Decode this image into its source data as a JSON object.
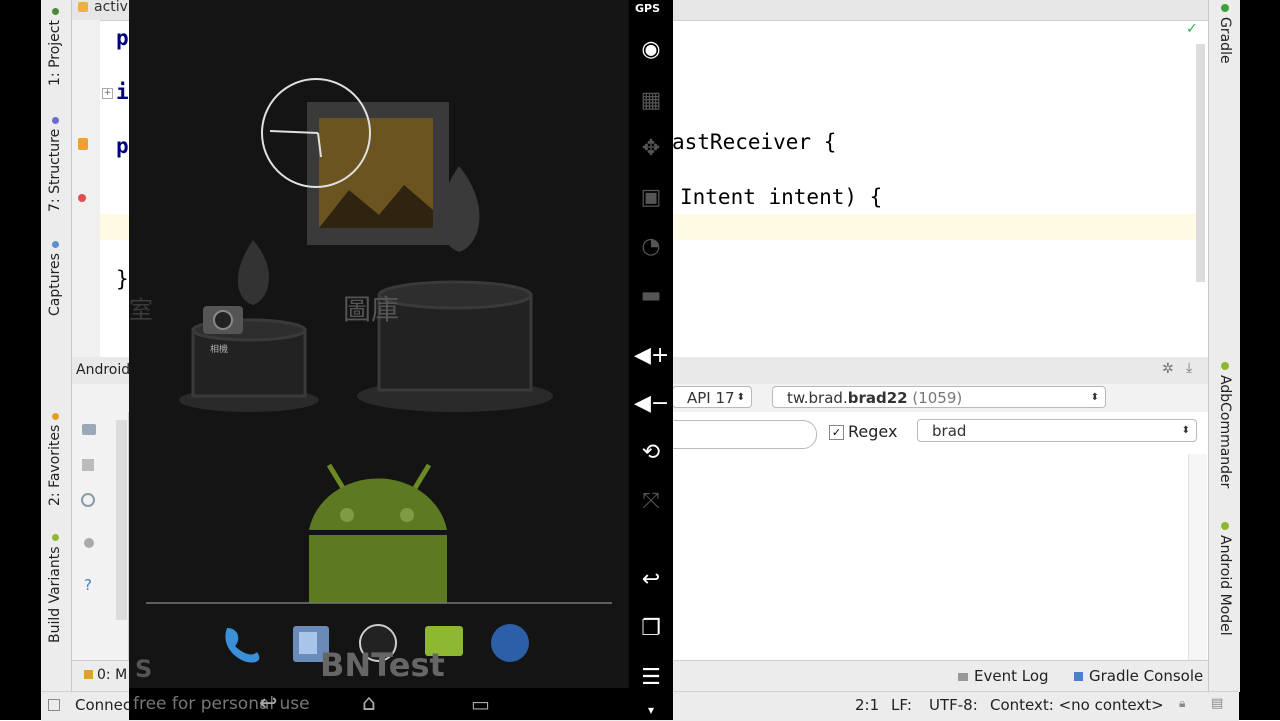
{
  "editor": {
    "tab_fragment": "activ",
    "code_partial_1": "astReceiver {",
    "code_partial_2": "Intent intent) {",
    "gutter_p1": "p",
    "gutter_i": "i",
    "gutter_p2": "p",
    "gutter_brace": "}"
  },
  "left_tabs": {
    "project": "1: Project",
    "structure": "7: Structure",
    "captures": "Captures",
    "favorites": "2: Favorites",
    "build_variants": "Build Variants"
  },
  "right_tabs": {
    "gradle": "Gradle",
    "adb_commander": "AdbCommander",
    "android_model": "Android Model"
  },
  "android_panel": {
    "title": "Android",
    "api_level": "API 17",
    "process": "tw.brad.",
    "process_bold": "brad22",
    "process_pid": " (1059)",
    "regex_label": "Regex",
    "filter": "brad"
  },
  "bottom_tabs": {
    "messages": "0: M",
    "event_log": "Event Log",
    "gradle_console": "Gradle Console"
  },
  "status_bar": {
    "message": "Connec",
    "position": "2:1",
    "line_sep": "LF:",
    "encoding": "UTF-8:",
    "context": "Context: <no context>"
  },
  "emulator": {
    "sidebar_top": "GPS",
    "camera_label": "相機",
    "gallery_label": "圖庫",
    "watermark": "BNTest",
    "watermark_sub": "free for personal use",
    "partial_glyph": "室"
  },
  "colors": {
    "android_green": "#8fb832",
    "gradle_green": "#40a040",
    "ide_bg": "#ececec",
    "current_line": "#fffae3"
  }
}
